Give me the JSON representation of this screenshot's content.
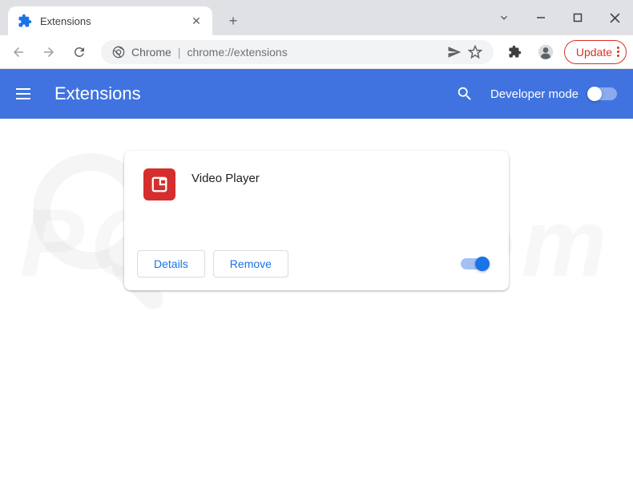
{
  "tab": {
    "title": "Extensions"
  },
  "address": {
    "host": "Chrome",
    "path": "chrome://extensions"
  },
  "toolbar": {
    "update_label": "Update"
  },
  "header": {
    "title": "Extensions",
    "developer_mode_label": "Developer mode"
  },
  "extension": {
    "name": "Video Player",
    "details_label": "Details",
    "remove_label": "Remove",
    "enabled": true
  },
  "watermark": {
    "text": "PCrisk.com"
  }
}
